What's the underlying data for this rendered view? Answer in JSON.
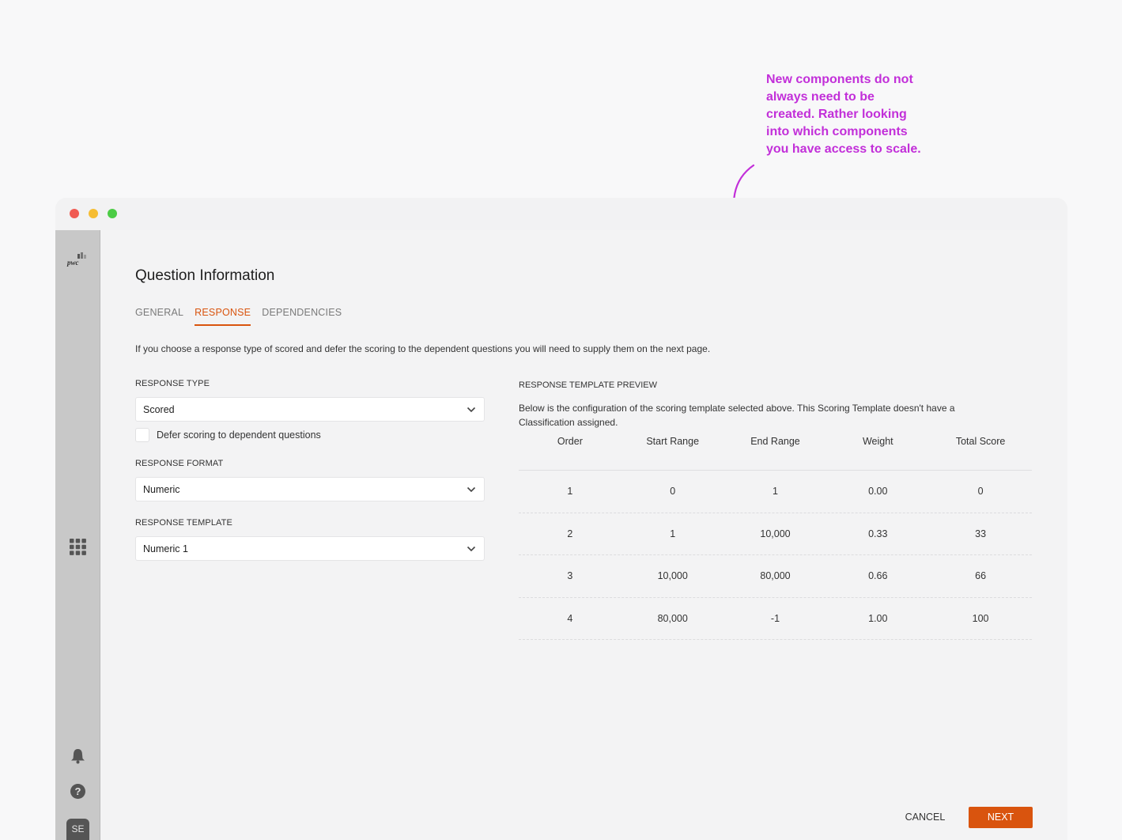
{
  "annotation": {
    "lines": [
      "New components do not",
      "always need to be",
      "created. Rather looking",
      "into which components",
      "you have access to scale."
    ],
    "color": "#c22fd9"
  },
  "sidebar": {
    "logo_text": "pwc",
    "avatar_initials": "SE",
    "help_glyph": "?",
    "icons": [
      "pwc-logo",
      "apps-grid-icon",
      "bell-icon",
      "help-icon"
    ]
  },
  "page": {
    "title": "Question Information",
    "tabs": [
      {
        "label": "GENERAL",
        "active": false
      },
      {
        "label": "RESPONSE",
        "active": true
      },
      {
        "label": "DEPENDENCIES",
        "active": false
      }
    ],
    "intro": "If you choose a response type of scored and defer the scoring to the dependent questions you will need to supply them on the next page."
  },
  "form": {
    "response_type": {
      "label": "RESPONSE TYPE",
      "value": "Scored"
    },
    "defer_scoring": {
      "label": "Defer scoring to dependent questions",
      "checked": false
    },
    "response_format": {
      "label": "RESPONSE FORMAT",
      "value": "Numeric"
    },
    "response_template": {
      "label": "RESPONSE TEMPLATE",
      "value": "Numeric 1"
    }
  },
  "preview": {
    "label": "RESPONSE TEMPLATE PREVIEW",
    "description": "Below is the configuration of the scoring template selected above. This Scoring Template doesn't have a Classification assigned.",
    "columns": [
      "Order",
      "Start Range",
      "End Range",
      "Weight",
      "Total Score"
    ],
    "rows": [
      [
        "1",
        "0",
        "1",
        "0.00",
        "0"
      ],
      [
        "2",
        "1",
        "10,000",
        "0.33",
        "33"
      ],
      [
        "3",
        "10,000",
        "80,000",
        "0.66",
        "66"
      ],
      [
        "4",
        "80,000",
        "-1",
        "1.00",
        "100"
      ]
    ]
  },
  "actions": {
    "cancel_label": "CANCEL",
    "next_label": "NEXT"
  },
  "colors": {
    "accent": "#d9540e",
    "annotation": "#c22fd9"
  }
}
